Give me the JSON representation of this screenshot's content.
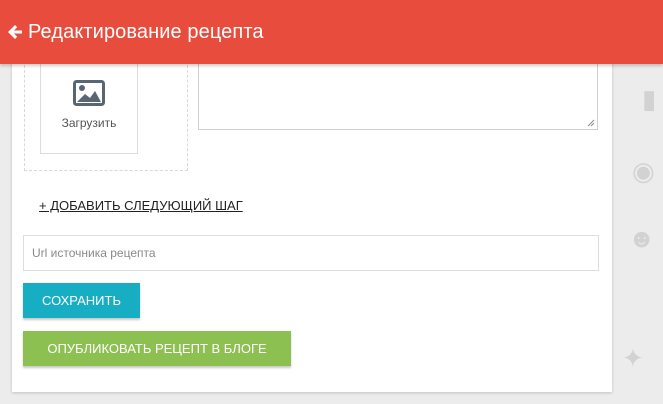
{
  "header": {
    "title": "Редактирование рецепта",
    "back_icon": "arrow-left-icon",
    "background_color": "#e84c3d"
  },
  "upload": {
    "icon": "image-icon",
    "label": "Загрузить"
  },
  "add_step": {
    "label": "+ ДОБАВИТЬ СЛЕДУЮЩИЙ ШАГ"
  },
  "source_url": {
    "placeholder": "Url источника рецепта",
    "value": ""
  },
  "buttons": {
    "save_label": "СОХРАНИТЬ",
    "save_color": "#17aec3",
    "publish_label": "ОПУБЛИКОВАТЬ РЕЦЕПТ В БЛОГЕ",
    "publish_color": "#8cc152"
  }
}
